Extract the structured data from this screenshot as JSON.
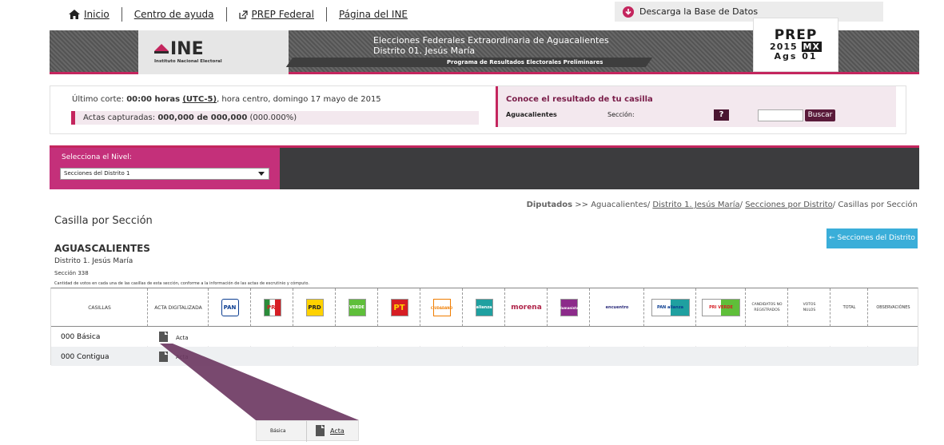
{
  "nav": {
    "inicio": "Inicio",
    "ayuda": "Centro de ayuda",
    "prep_federal": "PREP Federal",
    "ine": "Página del INE"
  },
  "download": {
    "label": "Descarga la Base de Datos"
  },
  "banner": {
    "logo_mark": "INE",
    "logo_sub": "Instituto Nacional Electoral",
    "title_line1": "Elecciones Federales Extraordinaria de Aguacalientes",
    "title_line2": "Distrito 01. Jesús María",
    "program": "Programa de Resultados Electorales Preliminares",
    "prep_top": "PREP",
    "prep_year": "2015",
    "prep_mx": "MX",
    "prep_ags": "Ags 01"
  },
  "status": {
    "cut_prefix": "Último corte: ",
    "cut_time": "00:00 horas",
    "cut_tz": "(UTC-5)",
    "cut_suffix": ", hora centro, domingo 17 mayo de 2015",
    "actas_prefix": "Actas capturadas: ",
    "actas_count": "000,000 de 000,000",
    "actas_pct": " (000.000%)"
  },
  "casilla_search": {
    "title": "Conoce el resultado de tu casilla",
    "state": "Aguacalientes",
    "section_label": "Sección:",
    "help": "?",
    "button": "Buscar"
  },
  "level": {
    "label": "Selecciona el Nivel:",
    "selected": "Secciones del Distrito 1"
  },
  "breadcrumb": {
    "root": "Diputados",
    "arrow": ">>",
    "state": "Aguacalientes/",
    "district": "Distrito 1. Jesús María",
    "slash1": "/",
    "sections": "Secciones por Distrito",
    "tail": "/ Casillas por Sección"
  },
  "page": {
    "title": "Casilla por Sección",
    "section_button": "← Secciones del Distrito",
    "state": "AGUASCALIENTES",
    "district": "Distrito 1. Jesús María",
    "section": "Sección 338",
    "description": "Cantidad de votos en cada una de las casillas de esta sección, conforme a la información de las actas de escrutinio y cómputo."
  },
  "table": {
    "headers": {
      "casillas": "CASILLAS",
      "acta": "ACTA DIGITALIZADA",
      "no_registrados": "CANDIDATOS NO REGISTRADOS",
      "nulos": "VOTOS NULOS",
      "total": "TOTAL",
      "observaciones": "OBSERVACIÓNES"
    },
    "parties": [
      "PAN",
      "PRI",
      "PRD",
      "VERDE",
      "PT",
      "CIUDADANO",
      "alianza",
      "morena",
      "Humanista",
      "encuentro",
      "PAN alianza",
      "PRI VERDE"
    ],
    "rows": [
      {
        "label": "000 Básica",
        "acta": "Acta"
      },
      {
        "label": "000 Contigua",
        "acta": "Acta"
      }
    ]
  },
  "zoom": {
    "label": "Básica",
    "acta": "Acta"
  }
}
